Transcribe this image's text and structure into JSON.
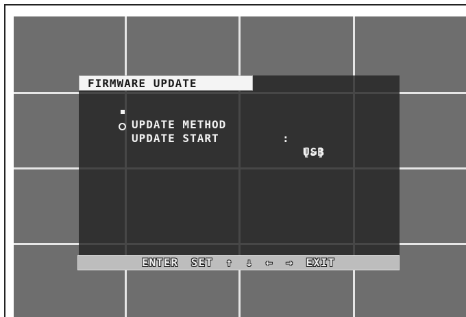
{
  "osd": {
    "title": "FIRMWARE UPDATE",
    "items": [
      {
        "label": "UPDATE METHOD",
        "separator": ":",
        "value": "USB",
        "bullet": "square-bullet-icon"
      },
      {
        "label": "UPDATE START",
        "separator": "",
        "value": "[↵]",
        "bullet": "circle-bullet-icon"
      }
    ]
  },
  "status_bar": {
    "enter": "ENTER",
    "set": "SET",
    "arrow_up": "↑",
    "arrow_down": "↓",
    "arrow_left": "←",
    "arrow_right": "→",
    "exit": "EXIT"
  },
  "colors": {
    "background_grid": "#6e6e6e",
    "grid_lines": "#e6e6e6",
    "osd_panel": "#232323",
    "title_bg": "#f4f4f4",
    "status_bar_bg": "#bdbdbd"
  }
}
